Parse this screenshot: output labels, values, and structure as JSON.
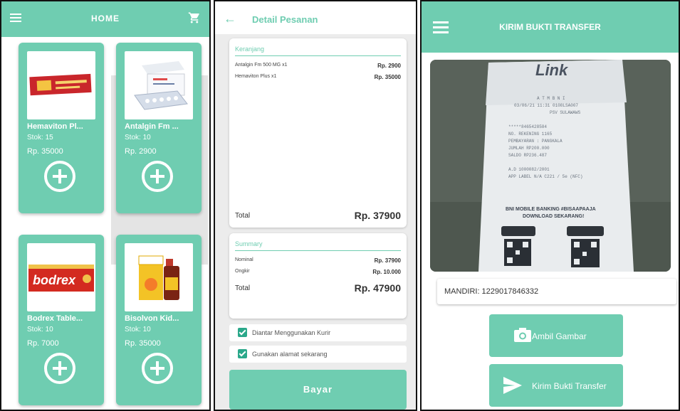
{
  "home": {
    "title": "HOME",
    "products": [
      {
        "name": "Hemaviton Pl...",
        "stock": "Stok: 15",
        "price": "Rp. 35000"
      },
      {
        "name": "Antalgin Fm ...",
        "stock": "Stok: 10",
        "price": "Rp. 2900"
      },
      {
        "name": "Bodrex Table...",
        "stock": "Stok: 10",
        "price": "Rp. 7000"
      },
      {
        "name": "Bisolvon Kid...",
        "stock": "Stok: 10",
        "price": "Rp. 35000"
      }
    ]
  },
  "order": {
    "title": "Detail Pesanan",
    "cart": {
      "heading": "Keranjang",
      "items": [
        {
          "name": "Antalgin Fm 500 MG x1",
          "price": "Rp. 2900"
        },
        {
          "name": "Hemaviton Plus x1",
          "price": "Rp. 35000"
        }
      ],
      "total_label": "Total",
      "total_value": "Rp. 37900"
    },
    "summary": {
      "heading": "Summary",
      "rows": [
        {
          "label": "Nominal",
          "value": "Rp. 37900"
        },
        {
          "label": "Ongkir",
          "value": "Rp. 10.000"
        }
      ],
      "total_label": "Total",
      "total_value": "Rp. 47900"
    },
    "options": [
      "Diantar Menggunakan Kurir",
      "Gunakan alamat sekarang"
    ],
    "pay_label": "Bayar"
  },
  "transfer": {
    "title": "KIRIM BUKTI TRANSFER",
    "receipt": {
      "logo": "Link",
      "lines": [
        "A T M   B N I",
        "03/06/21   11:31   0108LSA007",
        "PSV SULAWAWS",
        "*****8465428584",
        "NO. REKENING 1165",
        "PEMBAYARAN  :  PANGKALA",
        "JUMLAH          RP200.000",
        "SALDO           RP236.487",
        "A.D 1000082/2001",
        "APP LABEL  N/A  C221 / 5e  (NFC)",
        "BNI MOBILE BANKING #BISAAPAAJA",
        "DOWNLOAD SEKARANG!"
      ]
    },
    "bank_account": "MANDIRI: 1229017846332",
    "take_photo_label": "Ambil Gambar",
    "send_label": "Kirim Bukti Transfer"
  },
  "colors": {
    "accent": "#6fcdb1",
    "check": "#2aa88a"
  }
}
